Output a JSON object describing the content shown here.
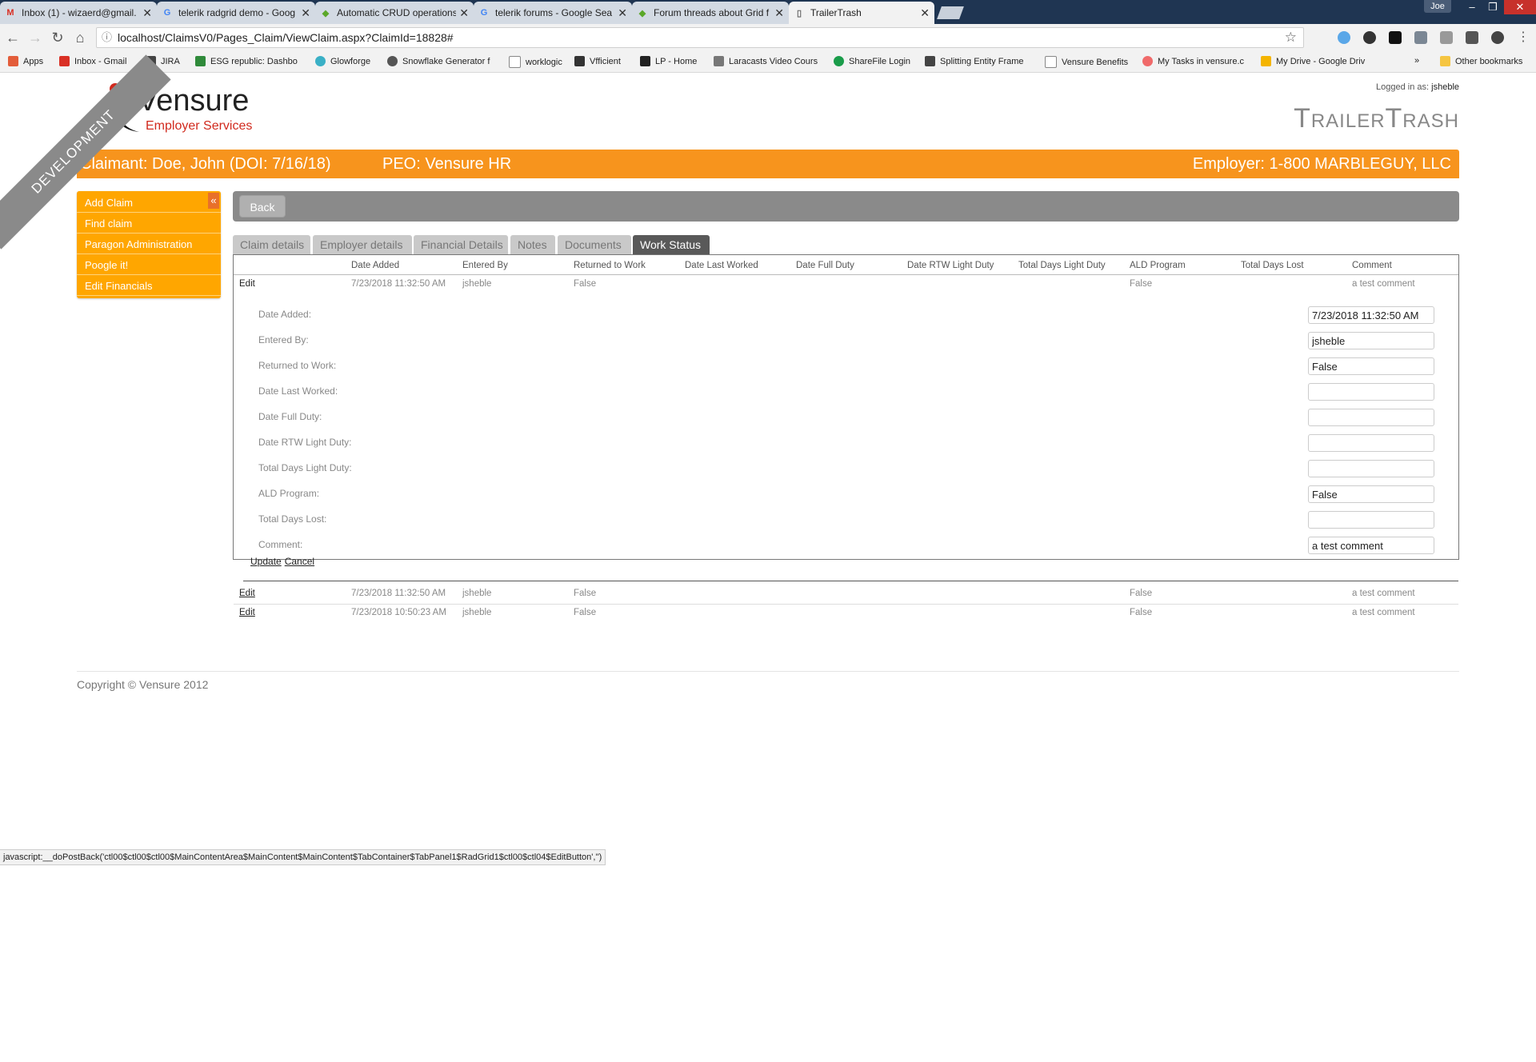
{
  "browser": {
    "tabs": [
      {
        "title": "Inbox (1) - wizaerd@gmail.",
        "icon": "gmail-icon",
        "active": false
      },
      {
        "title": "telerik radgrid demo - Goog",
        "icon": "google-icon",
        "active": false
      },
      {
        "title": "Automatic CRUD operations",
        "icon": "telerik-icon",
        "active": false
      },
      {
        "title": "telerik forums - Google Sea",
        "icon": "google-icon",
        "active": false
      },
      {
        "title": "Forum threads about Grid f",
        "icon": "telerik-icon",
        "active": false
      },
      {
        "title": "TrailerTrash",
        "icon": "page-icon",
        "active": true
      }
    ],
    "user_badge": "Joe",
    "url": "localhost/ClaimsV0/Pages_Claim/ViewClaim.aspx?ClaimId=18828#",
    "bookmarks": [
      "Apps",
      "Inbox - Gmail",
      "JIRA",
      "ESG republic: Dashbo",
      "Glowforge",
      "Snowflake Generator f",
      "worklogic",
      "Vfficient",
      "LP - Home",
      "Laracasts Video Cours",
      "ShareFile Login",
      "Splitting Entity Frame",
      "Vensure Benefits",
      "My Tasks in vensure.c",
      "My Drive - Google Driv"
    ],
    "overflow": "»",
    "other_bookmarks": "Other bookmarks"
  },
  "header": {
    "ribbon": "DEVELOPMENT",
    "logo_name": "Vensure",
    "logo_sub": "Employer Services",
    "logged_in_label": "Logged in as:",
    "logged_in_user": "jsheble",
    "site_title": "TrailerTrash"
  },
  "claim_bar": {
    "claimant": "Claimant:  Doe, John  (DOI: 7/16/18)",
    "peo": "PEO:  Vensure HR",
    "employer": "Employer:  1-800 MARBLEGUY, LLC"
  },
  "side_menu": {
    "collapse": "«",
    "items": [
      "Add Claim",
      "Find claim",
      "Paragon Administration",
      "Poogle it!",
      "Edit Financials"
    ]
  },
  "back_button": "Back",
  "tabs": [
    "Claim details",
    "Employer details",
    "Financial Details",
    "Notes",
    "Documents",
    "Work Status"
  ],
  "active_tab": "Work Status",
  "grid": {
    "columns": [
      "Date Added",
      "Entered By",
      "Returned to Work",
      "Date Last Worked",
      "Date Full Duty",
      "Date RTW Light Duty",
      "Total Days Light Duty",
      "ALD Program",
      "Total Days Lost",
      "Comment"
    ],
    "rows": [
      {
        "edit": "Edit",
        "date_added": "7/23/2018 11:32:50 AM",
        "entered_by": "jsheble",
        "returned": "False",
        "ald": "False",
        "comment": "a test comment"
      },
      {
        "edit": "Edit",
        "date_added": "7/23/2018 11:32:50 AM",
        "entered_by": "jsheble",
        "returned": "False",
        "ald": "False",
        "comment": "a test comment"
      },
      {
        "edit": "Edit",
        "date_added": "7/23/2018 10:50:23 AM",
        "entered_by": "jsheble",
        "returned": "False",
        "ald": "False",
        "comment": "a test comment"
      }
    ],
    "edit_form": {
      "fields": [
        {
          "label": "Date Added:",
          "value": "7/23/2018 11:32:50 AM"
        },
        {
          "label": "Entered By:",
          "value": "jsheble"
        },
        {
          "label": "Returned to Work:",
          "value": "False"
        },
        {
          "label": "Date Last Worked:",
          "value": ""
        },
        {
          "label": "Date Full Duty:",
          "value": ""
        },
        {
          "label": "Date RTW Light Duty:",
          "value": ""
        },
        {
          "label": "Total Days Light Duty:",
          "value": ""
        },
        {
          "label": "ALD Program:",
          "value": "False"
        },
        {
          "label": "Total Days Lost:",
          "value": ""
        },
        {
          "label": "Comment:",
          "value": "a test comment"
        }
      ],
      "update": "Update",
      "cancel": "Cancel"
    }
  },
  "footer": {
    "copyright": "Copyright © Vensure 2012"
  },
  "status_bar": "javascript:__doPostBack('ctl00$ctl00$ctl00$MainContentArea$MainContent$MainContent$TabContainer$TabPanel1$RadGrid1$ctl00$ctl04$EditButton','')",
  "colors": {
    "accent_orange": "#f7941d",
    "menu_orange": "#ffa600",
    "tab_active": "#595959",
    "logo_red": "#d12a1e"
  }
}
